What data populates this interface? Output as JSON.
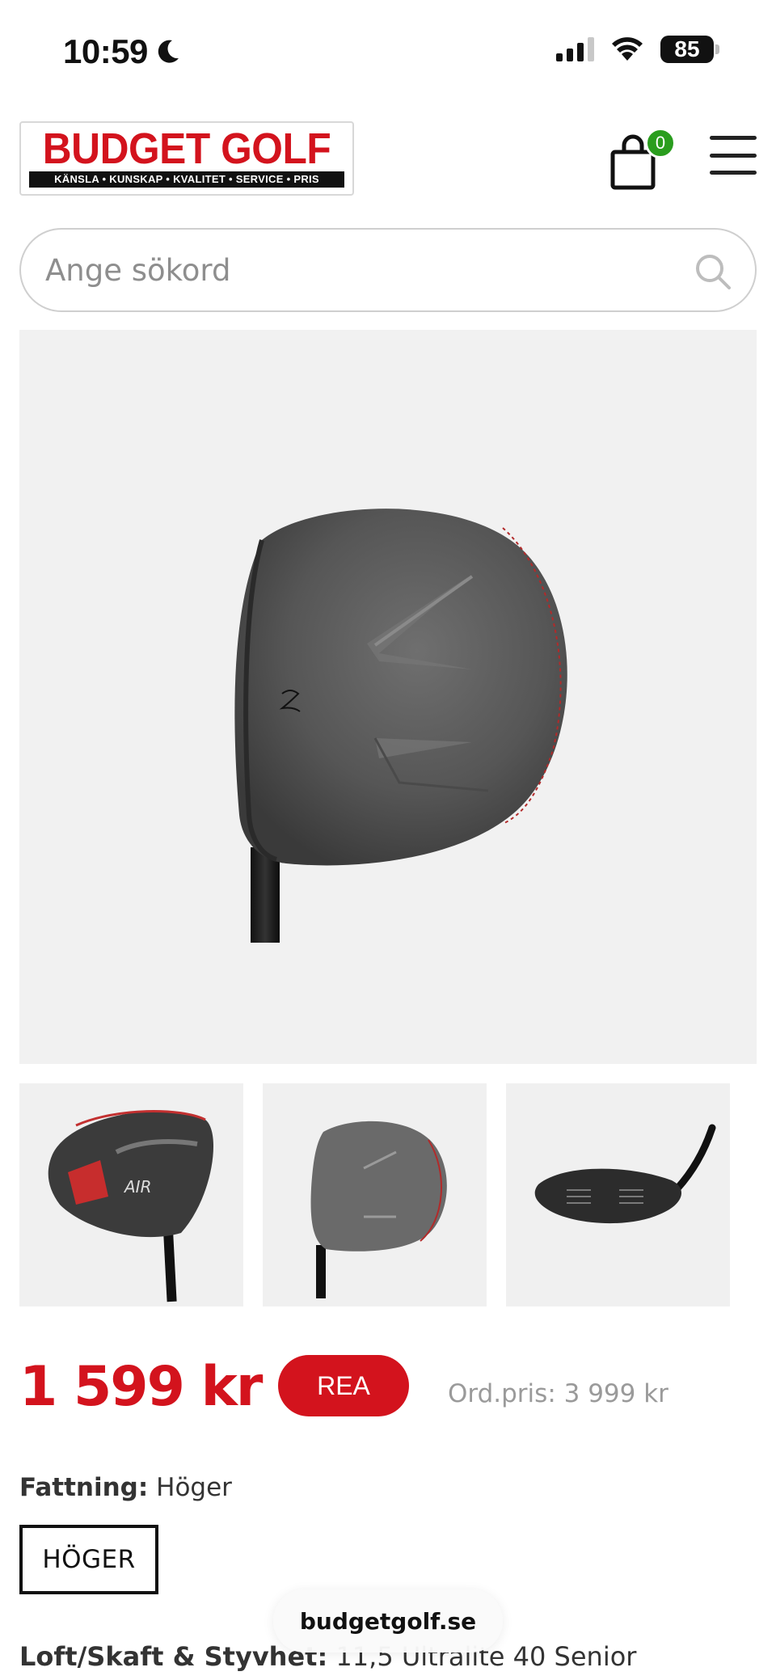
{
  "status_bar": {
    "time": "10:59",
    "battery": "85"
  },
  "header": {
    "logo_title": "BUDGET GOLF",
    "logo_tagline": "KÄNSLA • KUNSKAP • KVALITET • SERVICE • PRIS",
    "cart_count": "0",
    "brand_color": "#d3131d",
    "badge_color": "#2a9d1e"
  },
  "search": {
    "placeholder": "Ange sökord",
    "value": ""
  },
  "product": {
    "price": "1 599 kr",
    "sale_badge": "REA",
    "ordinary_price": "Ord.pris: 3 999 kr",
    "grip_label": "Fattning:",
    "grip_value": "Höger",
    "grip_option": "HÖGER",
    "loft_label": "Loft/Skaft & Styvhet:",
    "loft_value": "11,5 Ultralite 40 Senior"
  },
  "thumbnails": [
    {
      "icon": "driver-crown-thumbnail"
    },
    {
      "icon": "driver-top-thumbnail"
    },
    {
      "icon": "driver-sole-thumbnail"
    }
  ],
  "browser": {
    "url": "budgetgolf.se"
  }
}
